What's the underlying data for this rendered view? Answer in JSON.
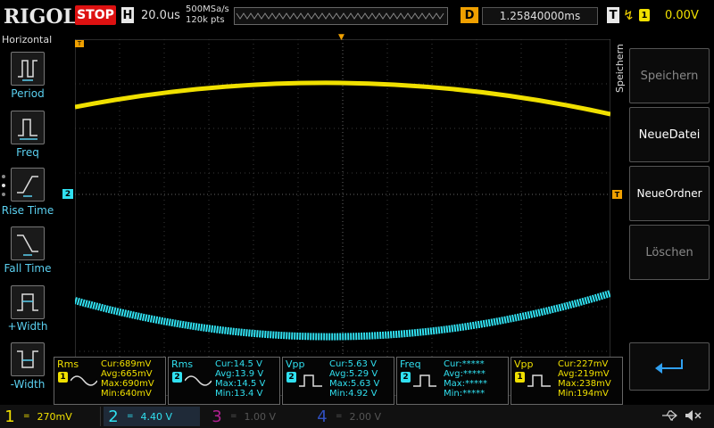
{
  "brand": "RIGOL",
  "run_state": "STOP",
  "horizontal": {
    "label": "H",
    "timebase": "20.0us",
    "sample_rate": "500MSa/s",
    "mem_depth": "120k pts"
  },
  "delay": {
    "label": "D",
    "value": "1.25840000ms"
  },
  "trigger": {
    "label": "T",
    "source": "1",
    "level": "0.00V"
  },
  "left_menu": {
    "title": "Horizontal",
    "items": [
      {
        "label": "Period",
        "icon": "period-icon"
      },
      {
        "label": "Freq",
        "icon": "freq-icon"
      },
      {
        "label": "Rise Time",
        "icon": "rise-time-icon"
      },
      {
        "label": "Fall Time",
        "icon": "fall-time-icon"
      },
      {
        "label": "+Width",
        "icon": "positive-width-icon"
      },
      {
        "label": "-Width",
        "icon": "negative-width-icon"
      }
    ]
  },
  "right_menu": {
    "title": "Speichern",
    "items": [
      {
        "label": "Speichern",
        "enabled": false
      },
      {
        "label": "NeueDatei",
        "enabled": true
      },
      {
        "label": "NeueOrdner",
        "enabled": true
      },
      {
        "label": "Löschen",
        "enabled": false
      }
    ],
    "back_icon": "return-arrow-icon"
  },
  "channel_marker_2": "2",
  "trigger_marker": "T",
  "measurements": [
    {
      "name": "Rms",
      "channel": "1",
      "color": "#f0e000",
      "rows": [
        [
          "Cur:",
          "689mV"
        ],
        [
          "Avg:",
          "665mV"
        ],
        [
          "Max:",
          "690mV"
        ],
        [
          "Min:",
          "640mV"
        ]
      ]
    },
    {
      "name": "Rms",
      "channel": "2",
      "color": "#30e0f0",
      "rows": [
        [
          "Cur:",
          "14.5 V"
        ],
        [
          "Avg:",
          "13.9 V"
        ],
        [
          "Max:",
          "14.5 V"
        ],
        [
          "Min:",
          "13.4 V"
        ]
      ]
    },
    {
      "name": "Vpp",
      "channel": "2",
      "color": "#30e0f0",
      "rows": [
        [
          "Cur:",
          "5.63 V"
        ],
        [
          "Avg:",
          "5.29 V"
        ],
        [
          "Max:",
          "5.63 V"
        ],
        [
          "Min:",
          "4.92 V"
        ]
      ]
    },
    {
      "name": "Freq",
      "channel": "2",
      "color": "#30e0f0",
      "rows": [
        [
          "Cur:",
          "*****"
        ],
        [
          "Avg:",
          "*****"
        ],
        [
          "Max:",
          "*****"
        ],
        [
          "Min:",
          "*****"
        ]
      ]
    },
    {
      "name": "Vpp",
      "channel": "1",
      "color": "#f0e000",
      "rows": [
        [
          "Cur:",
          "227mV"
        ],
        [
          "Avg:",
          "219mV"
        ],
        [
          "Max:",
          "238mV"
        ],
        [
          "Min:",
          "194mV"
        ]
      ]
    }
  ],
  "channels": [
    {
      "num": "1",
      "coupling": "=",
      "scale": "270mV",
      "color": "#f0e000",
      "active": true
    },
    {
      "num": "2",
      "coupling": "=",
      "scale": "4.40 V",
      "color": "#30e0f0",
      "active": true
    },
    {
      "num": "3",
      "coupling": "=",
      "scale": "1.00 V",
      "color": "#b02090",
      "active": false
    },
    {
      "num": "4",
      "coupling": "=",
      "scale": "2.00 V",
      "color": "#3050c0",
      "active": false
    }
  ],
  "status_icons": [
    "usb-icon",
    "speaker-muted-icon"
  ],
  "colors": {
    "ch1": "#f0e000",
    "ch2": "#30e0f0",
    "accent": "#f0a000",
    "stop": "#dd1111",
    "menu_text": "#5bd0f0"
  }
}
